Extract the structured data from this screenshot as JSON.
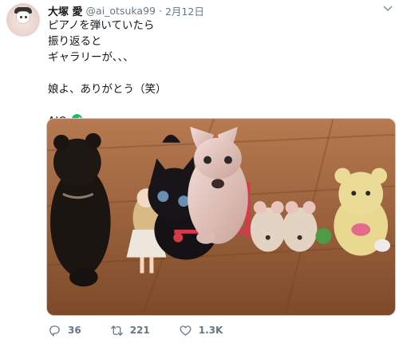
{
  "tweet": {
    "author_name": "大塚 愛",
    "handle": "@ai_otsuka99",
    "separator": "·",
    "date": "2月12日",
    "lines": [
      "ピアノを弾いていたら",
      "振り返ると",
      "ギャラリーが、、、",
      "",
      "娘よ、ありがとう（笑）",
      ""
    ],
    "signature": "AIO",
    "signature_icon": "check-circle-icon",
    "replies": "36",
    "retweets": "221",
    "likes": "1.3K"
  },
  "colors": {
    "text": "#14171a",
    "muted": "#657786",
    "verified_green": "#17bf63"
  }
}
